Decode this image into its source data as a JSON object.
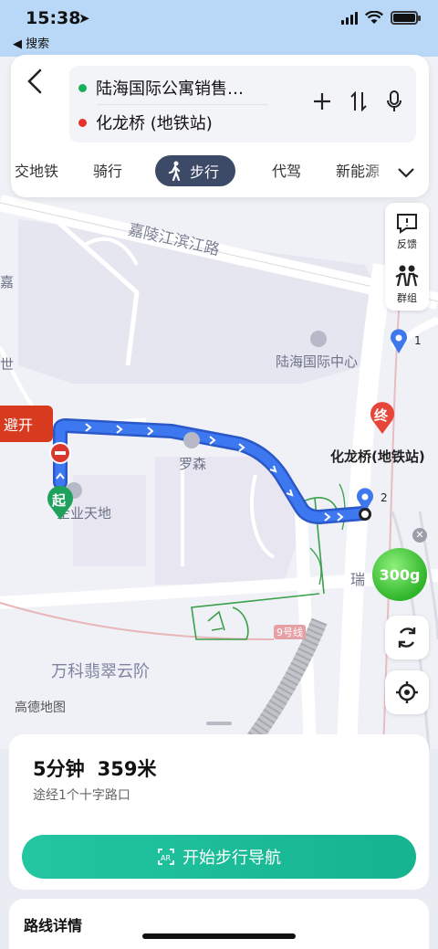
{
  "status_bar": {
    "time": "15:38",
    "back_app_label": "◀ 搜索"
  },
  "route": {
    "start": "陆海国际公寓销售…",
    "end": "化龙桥 (地铁站)",
    "start_color": "#18b05a",
    "end_color": "#e5322d"
  },
  "tabs": [
    {
      "label": "交地铁"
    },
    {
      "label": "骑行"
    },
    {
      "label": "步行",
      "active": true
    },
    {
      "label": "代驾"
    },
    {
      "label": "新能源"
    }
  ],
  "tools": {
    "feedback": "反馈",
    "group": "群组"
  },
  "map": {
    "road_1": "嘉陵江滨江路",
    "poi_center": "陆海国际中心",
    "poi_luosen": "罗森",
    "poi_tiandi": "企业天地",
    "poi_vanke": "万科翡翠云阶",
    "dest_label": "化龙桥(地铁站)",
    "dest_pin": "终",
    "start_pin": "起",
    "avoid": "避开",
    "road_rui": "瑞",
    "metro_line": "9号线",
    "road_left": "嘉",
    "road_left2": "世",
    "marker_1": "1",
    "marker_2": "2",
    "logo": "高德地图",
    "score": "300g",
    "route_color": "#2f67e4"
  },
  "summary": {
    "time": "5分钟",
    "distance": "359米",
    "via": "途经1个十字路口",
    "start_button": "开始步行导航",
    "button_color": "#1dbd98"
  },
  "details_title": "路线详情"
}
